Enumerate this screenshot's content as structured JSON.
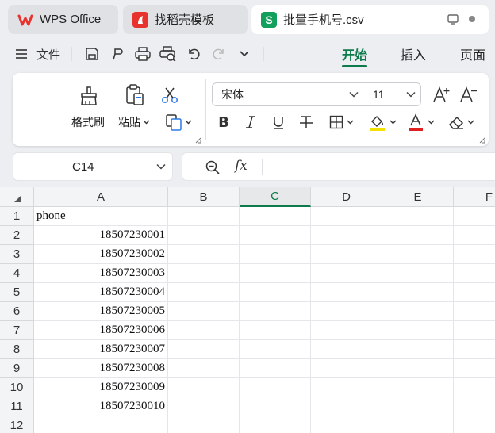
{
  "tabs": [
    {
      "label": "WPS Office",
      "icon": "wps-logo-icon"
    },
    {
      "label": "找稻壳模板",
      "icon": "docer-icon"
    },
    {
      "label": "批量手机号.csv",
      "icon": "spreadsheet-s-icon"
    }
  ],
  "menu": {
    "file_label": "文件",
    "ribbon_tabs": [
      "开始",
      "插入",
      "页面"
    ],
    "active_tab": "开始"
  },
  "ribbon": {
    "format_painter": "格式刷",
    "paste": "粘贴",
    "font_name": "宋体",
    "font_size": "11",
    "font_color": "#e02020",
    "highlight_color": "#f5e100"
  },
  "name_box": "C14",
  "formula_icon": "fx",
  "columns": [
    "A",
    "B",
    "C",
    "D",
    "E",
    "F"
  ],
  "selected_column": "C",
  "rows": [
    "1",
    "2",
    "3",
    "4",
    "5",
    "6",
    "7",
    "8",
    "9",
    "10",
    "11",
    "12"
  ],
  "column_a": [
    "phone",
    "18507230001",
    "18507230002",
    "18507230003",
    "18507230004",
    "18507230005",
    "18507230006",
    "18507230007",
    "18507230008",
    "18507230009",
    "18507230010",
    ""
  ],
  "accent": "#0c7a4a"
}
